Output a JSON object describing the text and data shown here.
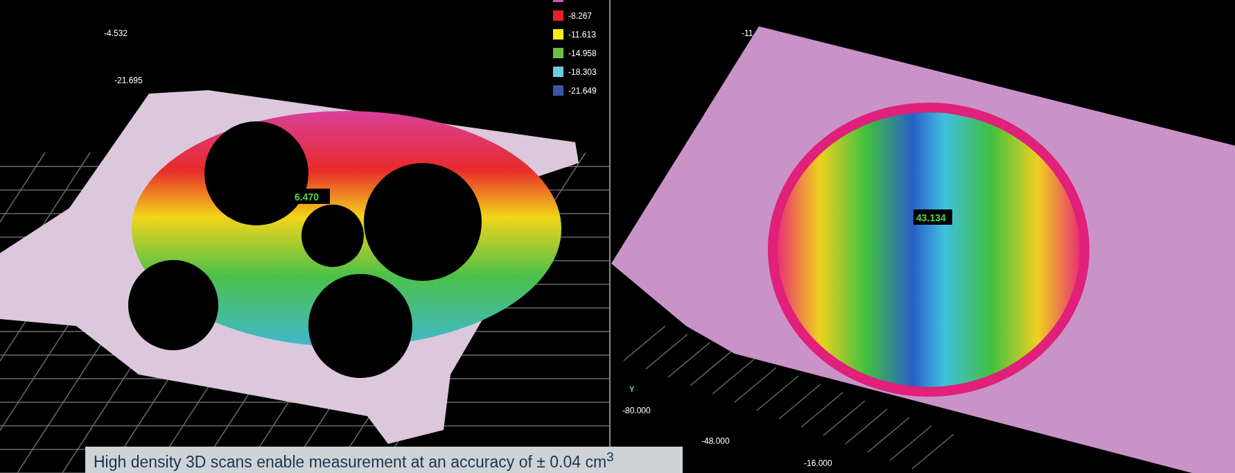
{
  "left_view": {
    "axis_labels": [
      "-4.532",
      "-21.695"
    ],
    "measurement": "6.470",
    "legend": [
      {
        "color": "#c45bb0"
      },
      {
        "label": "-8.267",
        "color": "#e81f27"
      },
      {
        "label": "-11.613",
        "color": "#f5ea14"
      },
      {
        "label": "-14.958",
        "color": "#6cbd45"
      },
      {
        "label": "-18.303",
        "color": "#6dcde0"
      },
      {
        "label": "-21.649",
        "color": "#3a55a4"
      }
    ]
  },
  "right_view": {
    "axis_labels": [
      "-11",
      "-80.000",
      "-48.000",
      "-16.000"
    ],
    "axis_name": "Y",
    "measurement": "43.134"
  },
  "caption": "High density 3D scans enable measurement at an accuracy of ± 0.04 cm$^{3}$"
}
